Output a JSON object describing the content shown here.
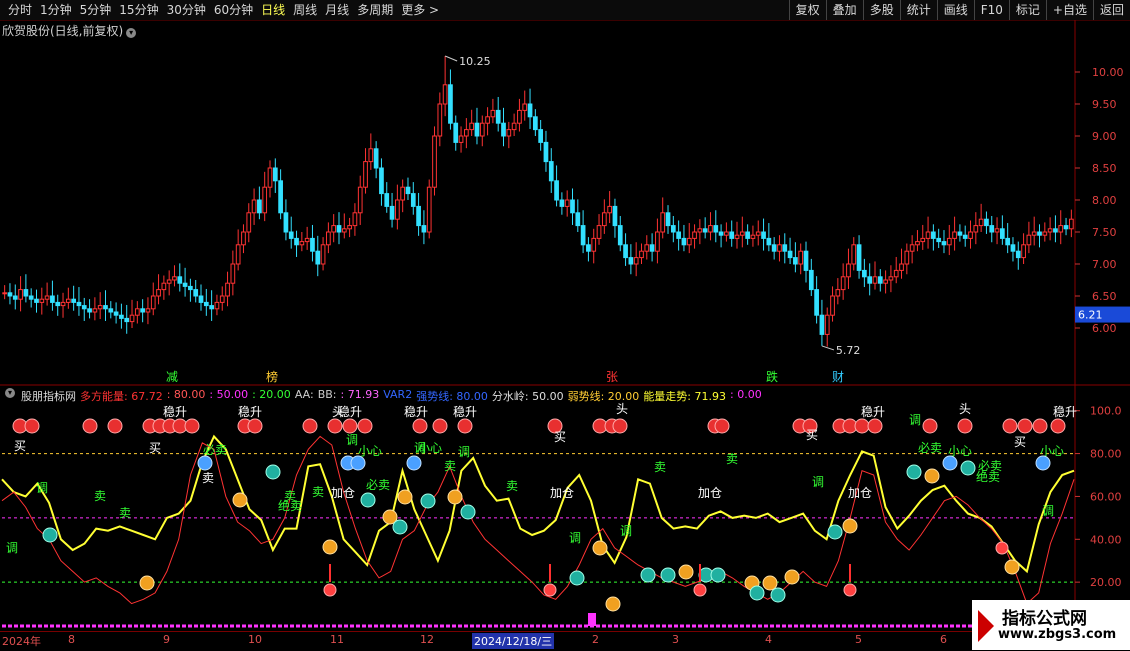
{
  "toolbar": {
    "periods": [
      "分时",
      "1分钟",
      "5分钟",
      "15分钟",
      "30分钟",
      "60分钟",
      "日线",
      "周线",
      "月线",
      "多周期",
      "更多 >"
    ],
    "active_index": 6,
    "right_buttons": [
      "复权",
      "叠加",
      "多股",
      "统计",
      "画线",
      "F10",
      "标记",
      "+自选",
      "返回"
    ]
  },
  "main_title": "欣贺股份(日线,前复权)",
  "price_panel": {
    "yticks": [
      "10.00",
      "9.50",
      "9.00",
      "8.50",
      "8.00",
      "7.50",
      "7.00",
      "6.50",
      "6.00"
    ],
    "high_label": "10.25",
    "low_label": "5.72",
    "current_price": "6.21",
    "events": [
      {
        "label": "减",
        "color": "#33ff33"
      },
      {
        "label": "榜",
        "color": "#ffcc33"
      },
      {
        "label": "张",
        "color": "#ff3333"
      },
      {
        "label": "跌",
        "color": "#33ff33"
      },
      {
        "label": "财",
        "color": "#33ccff"
      }
    ]
  },
  "indicator_panel": {
    "name": "股朋指标网",
    "legend": [
      {
        "text": "多方能量: 67.72",
        "color": "#ff3333"
      },
      {
        "text": ": 80.00",
        "color": "#ff5555"
      },
      {
        "text": ": 50.00",
        "color": "#ff33ff"
      },
      {
        "text": ": 20.00",
        "color": "#33ff33"
      },
      {
        "text": "AA:",
        "color": "#cccccc"
      },
      {
        "text": "BB:",
        "color": "#cccccc"
      },
      {
        "text": ": 71.93",
        "color": "#ff66ff"
      },
      {
        "text": "VAR2",
        "color": "#3366ff"
      },
      {
        "text": "强势线: 80.00",
        "color": "#3366ff"
      },
      {
        "text": "分水岭: 50.00",
        "color": "#dddddd"
      },
      {
        "text": "弱势线: 20.00",
        "color": "#ffcc33"
      },
      {
        "text": "能量走势: 71.93",
        "color": "#ffff33"
      },
      {
        "text": ": 0.00",
        "color": "#ff33ff"
      }
    ],
    "yticks": [
      "100.0",
      "80.00",
      "60.00",
      "40.00",
      "20.00"
    ],
    "signals": {
      "buy": "买",
      "sell": "卖",
      "stable_rise": "稳升",
      "adjust": "调",
      "careful": "小心",
      "add_position": "加仓",
      "must_sell": "必卖",
      "absolute_sell": "绝卖",
      "head": "头"
    }
  },
  "date_axis": [
    "2024年",
    "8",
    "9",
    "10",
    "11",
    "12",
    "2024/12/18/三",
    "2",
    "3",
    "4",
    "5",
    "6"
  ],
  "watermark": {
    "line1": "指标公式网",
    "line2": "www.zbgs3.com"
  },
  "chart_data": [
    {
      "type": "candlestick",
      "title": "欣贺股份(日线,前复权)",
      "ylim": [
        5.5,
        10.5
      ],
      "max": 10.25,
      "min": 5.72,
      "last": 6.21,
      "close": [
        6.55,
        6.5,
        6.45,
        6.6,
        6.5,
        6.45,
        6.4,
        6.45,
        6.5,
        6.4,
        6.35,
        6.4,
        6.45,
        6.4,
        6.35,
        6.3,
        6.25,
        6.3,
        6.35,
        6.3,
        6.25,
        6.2,
        6.15,
        6.1,
        6.2,
        6.3,
        6.25,
        6.3,
        6.5,
        6.6,
        6.7,
        6.75,
        6.8,
        6.7,
        6.65,
        6.6,
        6.5,
        6.4,
        6.35,
        6.3,
        6.4,
        6.5,
        6.7,
        7.0,
        7.3,
        7.5,
        7.8,
        8.0,
        7.8,
        8.2,
        8.5,
        8.3,
        7.8,
        7.5,
        7.4,
        7.3,
        7.35,
        7.4,
        7.2,
        7.0,
        7.3,
        7.5,
        7.6,
        7.5,
        7.55,
        7.6,
        7.8,
        8.2,
        8.6,
        8.8,
        8.5,
        8.1,
        7.9,
        7.7,
        8.0,
        8.2,
        8.1,
        7.9,
        7.6,
        7.5,
        8.2,
        9.0,
        9.5,
        9.8,
        9.2,
        8.9,
        9.0,
        9.1,
        9.2,
        9.0,
        9.2,
        9.3,
        9.4,
        9.2,
        9.0,
        9.1,
        9.2,
        9.4,
        9.5,
        9.3,
        9.1,
        8.9,
        8.6,
        8.3,
        8.0,
        7.9,
        8.0,
        7.8,
        7.6,
        7.3,
        7.2,
        7.4,
        7.6,
        7.8,
        7.9,
        7.6,
        7.3,
        7.1,
        7.0,
        7.1,
        7.2,
        7.3,
        7.2,
        7.5,
        7.8,
        7.6,
        7.5,
        7.4,
        7.3,
        7.4,
        7.5,
        7.55,
        7.5,
        7.6,
        7.5,
        7.45,
        7.5,
        7.4,
        7.45,
        7.5,
        7.4,
        7.45,
        7.5,
        7.4,
        7.3,
        7.2,
        7.3,
        7.2,
        7.1,
        7.0,
        7.2,
        6.9,
        6.6,
        6.2,
        5.9,
        6.2,
        6.5,
        6.6,
        6.8,
        7.0,
        7.3,
        6.9,
        6.8,
        6.7,
        6.8,
        6.7,
        6.75,
        6.8,
        6.9,
        7.0,
        7.2,
        7.3,
        7.35,
        7.4,
        7.5,
        7.4,
        7.35,
        7.3,
        7.4,
        7.5,
        7.45,
        7.4,
        7.5,
        7.6,
        7.7,
        7.6,
        7.5,
        7.55,
        7.4,
        7.3,
        7.2,
        7.1,
        7.3,
        7.45,
        7.5,
        7.45,
        7.5,
        7.55,
        7.5,
        7.6,
        7.55,
        7.7
      ]
    },
    {
      "type": "line",
      "title": "股朋指标网",
      "ylim": [
        0,
        105
      ],
      "reference_lines": [
        {
          "name": "强势线",
          "value": 80,
          "color": "#ffcc33"
        },
        {
          "name": "分水岭",
          "value": 50,
          "color": "#ff33ff"
        },
        {
          "name": "弱势线",
          "value": 20,
          "color": "#33ff33"
        }
      ],
      "series": [
        {
          "name": "能量走势",
          "color": "#ffff33",
          "values": [
            68,
            62,
            60,
            66,
            57,
            40,
            35,
            38,
            45,
            44,
            46,
            44,
            42,
            40,
            50,
            52,
            58,
            76,
            88,
            82,
            68,
            54,
            49,
            35,
            45,
            45,
            74,
            75,
            60,
            40,
            34,
            28,
            44,
            48,
            72,
            54,
            42,
            30,
            44,
            72,
            78,
            65,
            58,
            59,
            45,
            42,
            44,
            49,
            64,
            70,
            58,
            37,
            29,
            41,
            68,
            66,
            50,
            45,
            46,
            45,
            51,
            53,
            50,
            51,
            50,
            52,
            48,
            50,
            52,
            44,
            40,
            58,
            70,
            81,
            79,
            55,
            45,
            51,
            58,
            63,
            65,
            58,
            52,
            50,
            46,
            38,
            30,
            25,
            47,
            62,
            70,
            72
          ]
        },
        {
          "name": "多方能量",
          "color": "#ff3333",
          "values": [
            58,
            62,
            55,
            45,
            40,
            30,
            25,
            20,
            22,
            18,
            15,
            10,
            12,
            15,
            25,
            40,
            70,
            85,
            82,
            60,
            48,
            44,
            38,
            40,
            50,
            70,
            82,
            88,
            84,
            62,
            45,
            30,
            22,
            25,
            40,
            44,
            55,
            62,
            74,
            60,
            48,
            40,
            35,
            30,
            25,
            20,
            14,
            12,
            18,
            28,
            40,
            45,
            36,
            32,
            28,
            25,
            22,
            20,
            18,
            20,
            22,
            25,
            22,
            18,
            15,
            12,
            15,
            20,
            25,
            20,
            18,
            30,
            50,
            72,
            70,
            48,
            40,
            35,
            42,
            50,
            58,
            60,
            56,
            50,
            45,
            38,
            25,
            10,
            15,
            38,
            52,
            68
          ]
        }
      ]
    }
  ]
}
